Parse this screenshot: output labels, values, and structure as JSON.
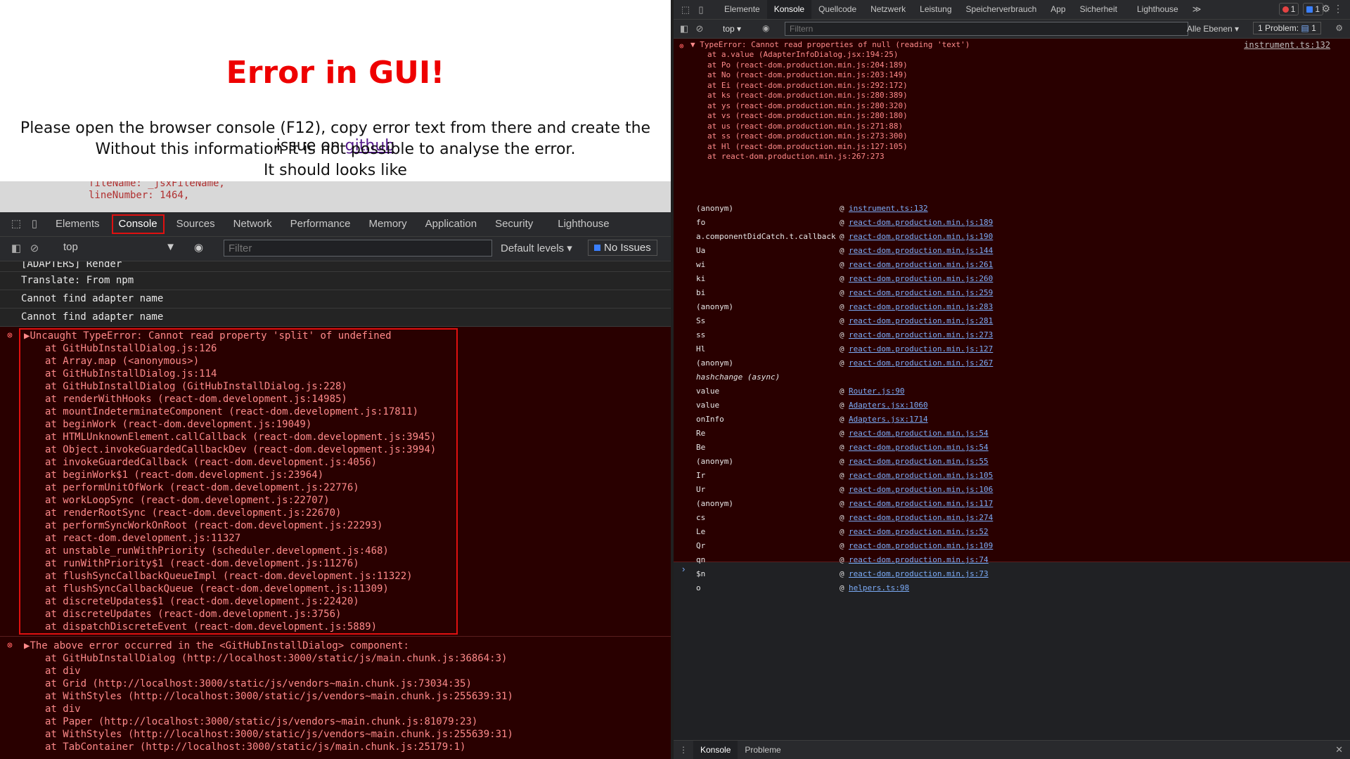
{
  "left": {
    "error_title": "Error in GUI!",
    "line1_prefix": "Please open the browser console (F12), copy error text from there and create the issue on ",
    "line1_link": "github",
    "line2": "Without this information it is not possible to analyse the error.",
    "line3": "It should looks like",
    "code_peek": [
      "fileName: _jsxFileName,",
      "lineNumber: 1464,"
    ],
    "tabs": [
      "Elements",
      "Console",
      "Sources",
      "Network",
      "Performance",
      "Memory",
      "Application",
      "Security",
      "Lighthouse"
    ],
    "context": "top",
    "filter_placeholder": "Filter",
    "levels": "Default levels",
    "no_issues": "No Issues",
    "log_partial": "[ADAPTERS] Render",
    "logs": [
      "Translate: From npm",
      "Cannot find adapter name",
      "Cannot find adapter name"
    ],
    "error1_head": "Uncaught TypeError: Cannot read property 'split' of undefined",
    "error1_frames": [
      "at GitHubInstallDialog.js:126",
      "at Array.map (<anonymous>)",
      "at GitHubInstallDialog.js:114",
      "at GitHubInstallDialog (GitHubInstallDialog.js:228)",
      "at renderWithHooks (react-dom.development.js:14985)",
      "at mountIndeterminateComponent (react-dom.development.js:17811)",
      "at beginWork (react-dom.development.js:19049)",
      "at HTMLUnknownElement.callCallback (react-dom.development.js:3945)",
      "at Object.invokeGuardedCallbackDev (react-dom.development.js:3994)",
      "at invokeGuardedCallback (react-dom.development.js:4056)",
      "at beginWork$1 (react-dom.development.js:23964)",
      "at performUnitOfWork (react-dom.development.js:22776)",
      "at workLoopSync (react-dom.development.js:22707)",
      "at renderRootSync (react-dom.development.js:22670)",
      "at performSyncWorkOnRoot (react-dom.development.js:22293)",
      "at react-dom.development.js:11327",
      "at unstable_runWithPriority (scheduler.development.js:468)",
      "at runWithPriority$1 (react-dom.development.js:11276)",
      "at flushSyncCallbackQueueImpl (react-dom.development.js:11322)",
      "at flushSyncCallbackQueue (react-dom.development.js:11309)",
      "at discreteUpdates$1 (react-dom.development.js:22420)",
      "at discreteUpdates (react-dom.development.js:3756)",
      "at dispatchDiscreteEvent (react-dom.development.js:5889)"
    ],
    "error2_head": "The above error occurred in the <GitHubInstallDialog> component:",
    "error2_frames": [
      "",
      "at GitHubInstallDialog (http://localhost:3000/static/js/main.chunk.js:36864:3)",
      "at div",
      "at Grid (http://localhost:3000/static/js/vendors~main.chunk.js:73034:35)",
      "at WithStyles (http://localhost:3000/static/js/vendors~main.chunk.js:255639:31)",
      "at div",
      "at Paper (http://localhost:3000/static/js/vendors~main.chunk.js:81079:23)",
      "at WithStyles (http://localhost:3000/static/js/vendors~main.chunk.js:255639:31)",
      "at TabContainer (http://localhost:3000/static/js/main.chunk.js:25179:1)"
    ]
  },
  "right": {
    "tabs": [
      "Elemente",
      "Konsole",
      "Quellcode",
      "Netzwerk",
      "Leistung",
      "Speicherverbrauch",
      "App",
      "Sicherheit",
      "Lighthouse"
    ],
    "more": "≫",
    "err_badge": "1",
    "msg_badge": "1",
    "context": "top",
    "filter_placeholder": "Filtern",
    "levels": "Alle Ebenen",
    "problem_label": "1 Problem:",
    "problem_count": "1",
    "error_head": "TypeError: Cannot read properties of null (reading 'text')",
    "error_source": "instrument.ts:132",
    "error_frames": [
      "at a.value (AdapterInfoDialog.jsx:194:25)",
      "at Po (react-dom.production.min.js:204:189)",
      "at No (react-dom.production.min.js:203:149)",
      "at Ei (react-dom.production.min.js:292:172)",
      "at ks (react-dom.production.min.js:280:389)",
      "at ys (react-dom.production.min.js:280:320)",
      "at vs (react-dom.production.min.js:280:180)",
      "at us (react-dom.production.min.js:271:88)",
      "at ss (react-dom.production.min.js:273:300)",
      "at Hl (react-dom.production.min.js:127:105)",
      "at react-dom.production.min.js:267:273"
    ],
    "stack": [
      {
        "fn": "(anonym)",
        "loc": "instrument.ts:132"
      },
      {
        "fn": "fo",
        "loc": "react-dom.production.min.js:189"
      },
      {
        "fn": "a.componentDidCatch.t.callback",
        "loc": "react-dom.production.min.js:190"
      },
      {
        "fn": "Ua",
        "loc": "react-dom.production.min.js:144"
      },
      {
        "fn": "wi",
        "loc": "react-dom.production.min.js:261"
      },
      {
        "fn": "ki",
        "loc": "react-dom.production.min.js:260"
      },
      {
        "fn": "bi",
        "loc": "react-dom.production.min.js:259"
      },
      {
        "fn": "(anonym)",
        "loc": "react-dom.production.min.js:283"
      },
      {
        "fn": "Ss",
        "loc": "react-dom.production.min.js:281"
      },
      {
        "fn": "ss",
        "loc": "react-dom.production.min.js:273"
      },
      {
        "fn": "Hl",
        "loc": "react-dom.production.min.js:127"
      },
      {
        "fn": "(anonym)",
        "loc": "react-dom.production.min.js:267"
      },
      {
        "fn": "hashchange (async)",
        "loc": "",
        "async": true
      },
      {
        "fn": "value",
        "loc": "Router.js:90"
      },
      {
        "fn": "value",
        "loc": "Adapters.jsx:1060"
      },
      {
        "fn": "onInfo",
        "loc": "Adapters.jsx:1714"
      },
      {
        "fn": "Re",
        "loc": "react-dom.production.min.js:54"
      },
      {
        "fn": "Be",
        "loc": "react-dom.production.min.js:54"
      },
      {
        "fn": "(anonym)",
        "loc": "react-dom.production.min.js:55"
      },
      {
        "fn": "Ir",
        "loc": "react-dom.production.min.js:105"
      },
      {
        "fn": "Ur",
        "loc": "react-dom.production.min.js:106"
      },
      {
        "fn": "(anonym)",
        "loc": "react-dom.production.min.js:117"
      },
      {
        "fn": "cs",
        "loc": "react-dom.production.min.js:274"
      },
      {
        "fn": "Le",
        "loc": "react-dom.production.min.js:52"
      },
      {
        "fn": "Qr",
        "loc": "react-dom.production.min.js:109"
      },
      {
        "fn": "qn",
        "loc": "react-dom.production.min.js:74"
      },
      {
        "fn": "$n",
        "loc": "react-dom.production.min.js:73"
      },
      {
        "fn": "o",
        "loc": "helpers.ts:98"
      }
    ],
    "drawer_tabs": [
      "Konsole",
      "Probleme"
    ]
  },
  "colors": {
    "error_red": "#ee0000",
    "link_blue": "#7cacf8",
    "error_bg": "#290000"
  }
}
